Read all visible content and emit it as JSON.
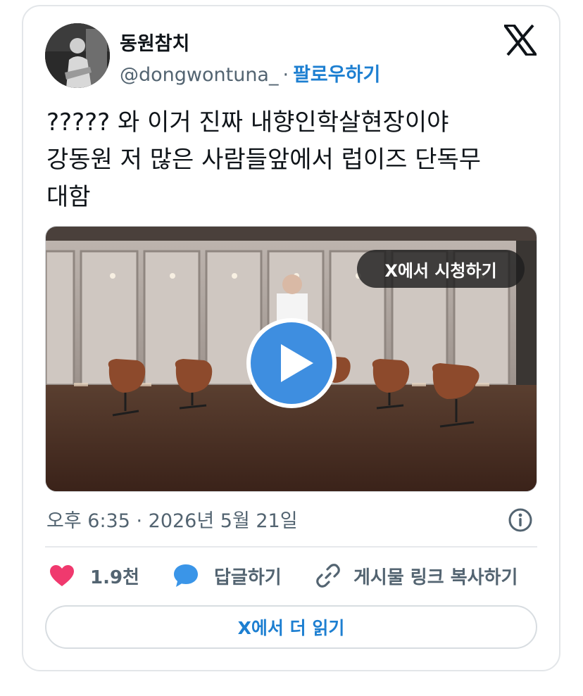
{
  "user": {
    "display_name": "동원참치",
    "handle": "@dongwontuna_",
    "separator": "·",
    "follow_label": "팔로우하기"
  },
  "tweet": {
    "lines": [
      "????? 와 이거 진짜 내향인학살현장이야",
      "강동원 저 많은 사람들앞에서 럽이즈 단독무",
      "대함"
    ]
  },
  "media": {
    "watch_label": "X에서 시청하기",
    "type": "video"
  },
  "meta": {
    "timestamp": "오후 6:35 · 2026년 5월 21일"
  },
  "actions": {
    "like_count": "1.9천",
    "reply_label": "답글하기",
    "copy_link_label": "게시물 링크 복사하기"
  },
  "footer": {
    "read_more_label": "X에서 더 읽기"
  },
  "colors": {
    "accent": "#1d7fd1",
    "like": "#f0396e",
    "reply": "#3a95e8",
    "muted": "#536471",
    "text": "#0f1419",
    "play": "#3e8ee0"
  }
}
